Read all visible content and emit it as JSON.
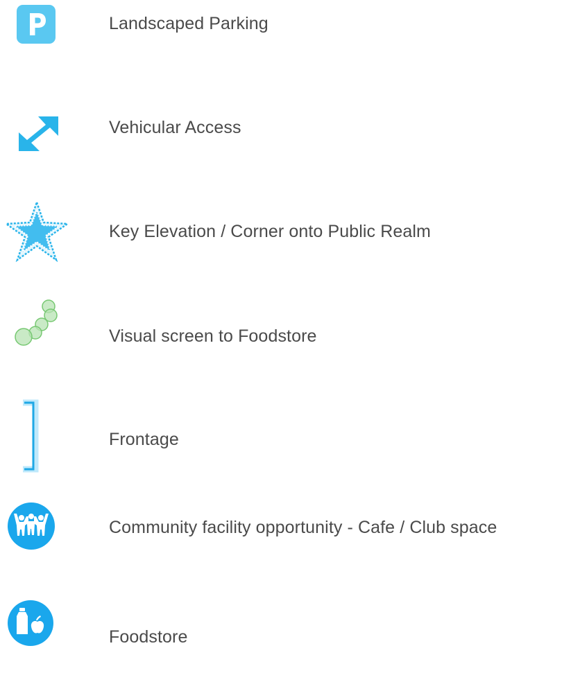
{
  "legend": {
    "items": [
      {
        "label": "Landscaped Parking",
        "icon": "parking-icon",
        "color": "#56c6f0"
      },
      {
        "label": "Vehicular Access",
        "icon": "double-arrow-icon",
        "color": "#29b4ea"
      },
      {
        "label": "Key Elevation / Corner onto Public Realm",
        "icon": "dotted-star-icon",
        "color": "#29b4ea"
      },
      {
        "label": "Visual screen to Foodstore",
        "icon": "tree-circles-icon",
        "color": "#8fd18a"
      },
      {
        "label": "Frontage",
        "icon": "bracket-icon",
        "color": "#1ea8e6"
      },
      {
        "label": "Community facility opportunity - Cafe / Club space",
        "icon": "community-people-icon",
        "color": "#1aa7ec"
      },
      {
        "label": "Foodstore",
        "icon": "foodstore-icon",
        "color": "#1aa7ec"
      }
    ]
  }
}
